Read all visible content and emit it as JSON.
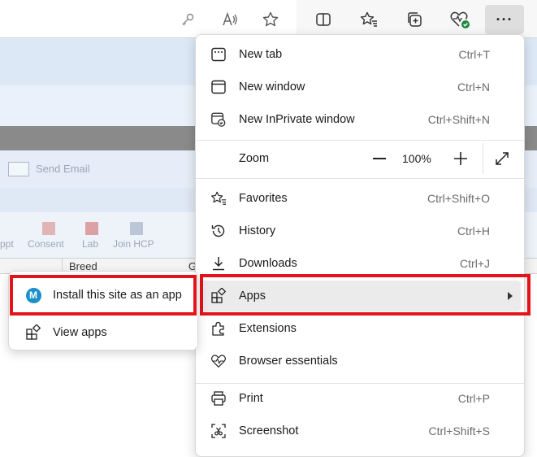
{
  "toolbar": {
    "icons": [
      "key-icon",
      "read-aloud-icon",
      "favorite-star-icon",
      "split-screen-icon",
      "favorites-icon",
      "collections-icon",
      "browser-essentials-icon",
      "more-icon"
    ],
    "more_label": "···"
  },
  "background_page": {
    "send_email_label": "Send Email",
    "toolbar_labels": [
      "ppt",
      "Consent",
      "Lab",
      "Join HCP"
    ],
    "column_header": "Breed",
    "column_header_2": "G"
  },
  "menu": {
    "items": [
      {
        "label": "New tab",
        "shortcut": "Ctrl+T"
      },
      {
        "label": "New window",
        "shortcut": "Ctrl+N"
      },
      {
        "label": "New InPrivate window",
        "shortcut": "Ctrl+Shift+N"
      },
      {
        "label": "Zoom",
        "shortcut": ""
      },
      {
        "label": "Favorites",
        "shortcut": "Ctrl+Shift+O"
      },
      {
        "label": "History",
        "shortcut": "Ctrl+H"
      },
      {
        "label": "Downloads",
        "shortcut": "Ctrl+J"
      },
      {
        "label": "Apps",
        "shortcut": ""
      },
      {
        "label": "Extensions",
        "shortcut": ""
      },
      {
        "label": "Browser essentials",
        "shortcut": ""
      },
      {
        "label": "Print",
        "shortcut": "Ctrl+P"
      },
      {
        "label": "Screenshot",
        "shortcut": "Ctrl+Shift+S"
      }
    ],
    "zoom": {
      "minus": "—",
      "value": "100%",
      "plus": "+"
    }
  },
  "submenu": {
    "items": [
      {
        "label": "Install this site as an app"
      },
      {
        "label": "View apps"
      }
    ],
    "app_logo_letter": "M"
  },
  "colors": {
    "highlight": "#e3151a",
    "accent_app_logo": "#1a8fc9"
  }
}
